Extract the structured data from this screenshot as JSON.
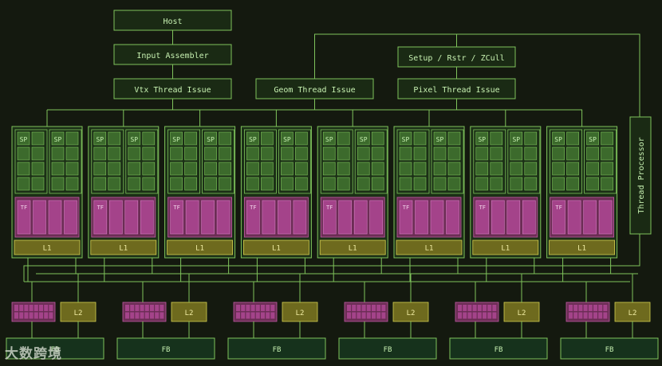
{
  "nodes": {
    "host": "Host",
    "input_assembler": "Input Assembler",
    "vtx_thread_issue": "Vtx Thread Issue",
    "geom_thread_issue": "Geom Thread Issue",
    "setup_rstr_zcull": "Setup / Rstr / ZCull",
    "pixel_thread_issue": "Pixel Thread Issue",
    "thread_processor": "Thread Processor"
  },
  "cluster": {
    "sp_label": "SP",
    "tf_label": "TF",
    "l1_label": "L1",
    "count": 8
  },
  "memory": {
    "l2_label": "L2",
    "fb_label": "FB",
    "partitions": 6
  },
  "watermark": "大数跨境",
  "colors": {
    "background": "#14190f",
    "line": "#7fc35b",
    "text": "#c6f0b0",
    "node_fill": "#1a2a14",
    "cluster_fill": "#1b2f16",
    "sp_fill": "#3c6a2c",
    "tf_fill": "#6c2d55",
    "tf_cell": "#a4438a",
    "l2_fill": "#6e6a1e",
    "fb_fill": "#16321c"
  }
}
